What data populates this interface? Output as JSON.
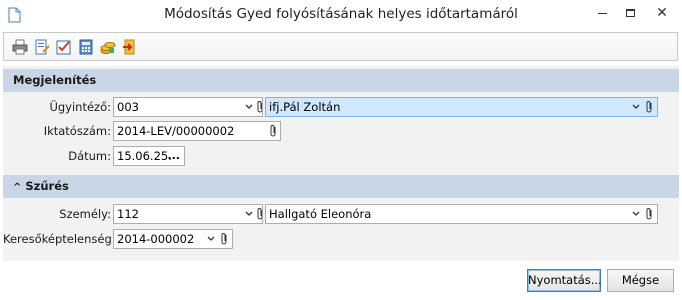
{
  "window": {
    "title": "Módosítás Gyed folyósításának helyes időtartamáról"
  },
  "toolbar": {
    "buttons": [
      {
        "icon": "printer-icon"
      },
      {
        "icon": "edit-document-icon"
      },
      {
        "icon": "checklist-icon"
      },
      {
        "icon": "calculator-icon"
      },
      {
        "icon": "coins-icon"
      },
      {
        "icon": "exit-icon"
      }
    ]
  },
  "sections": {
    "display": {
      "title": "Megjelenítés",
      "agent_label": "Ügyintéző:",
      "agent_code": "003",
      "agent_name": "ifj.Pál Zoltán",
      "filing_label": "Iktatószám:",
      "filing_value": "2014-LEV/00000002",
      "date_label": "Dátum:",
      "date_value": "15.06.25.",
      "date_button": "..."
    },
    "filter": {
      "title": "Szűrés",
      "person_label": "Személy:",
      "person_code": "112",
      "person_name": "Hallgató Eleonóra",
      "incapacity_label": "Keresőképtelenség:",
      "incapacity_value": "2014-000002"
    }
  },
  "footer": {
    "print_label": "Nyomtatás...",
    "cancel_label": "Mégse"
  },
  "colors": {
    "section_header": "#c9d6e5",
    "content_bg": "#f2f2f2",
    "highlight_field": "#cfe8fb"
  }
}
